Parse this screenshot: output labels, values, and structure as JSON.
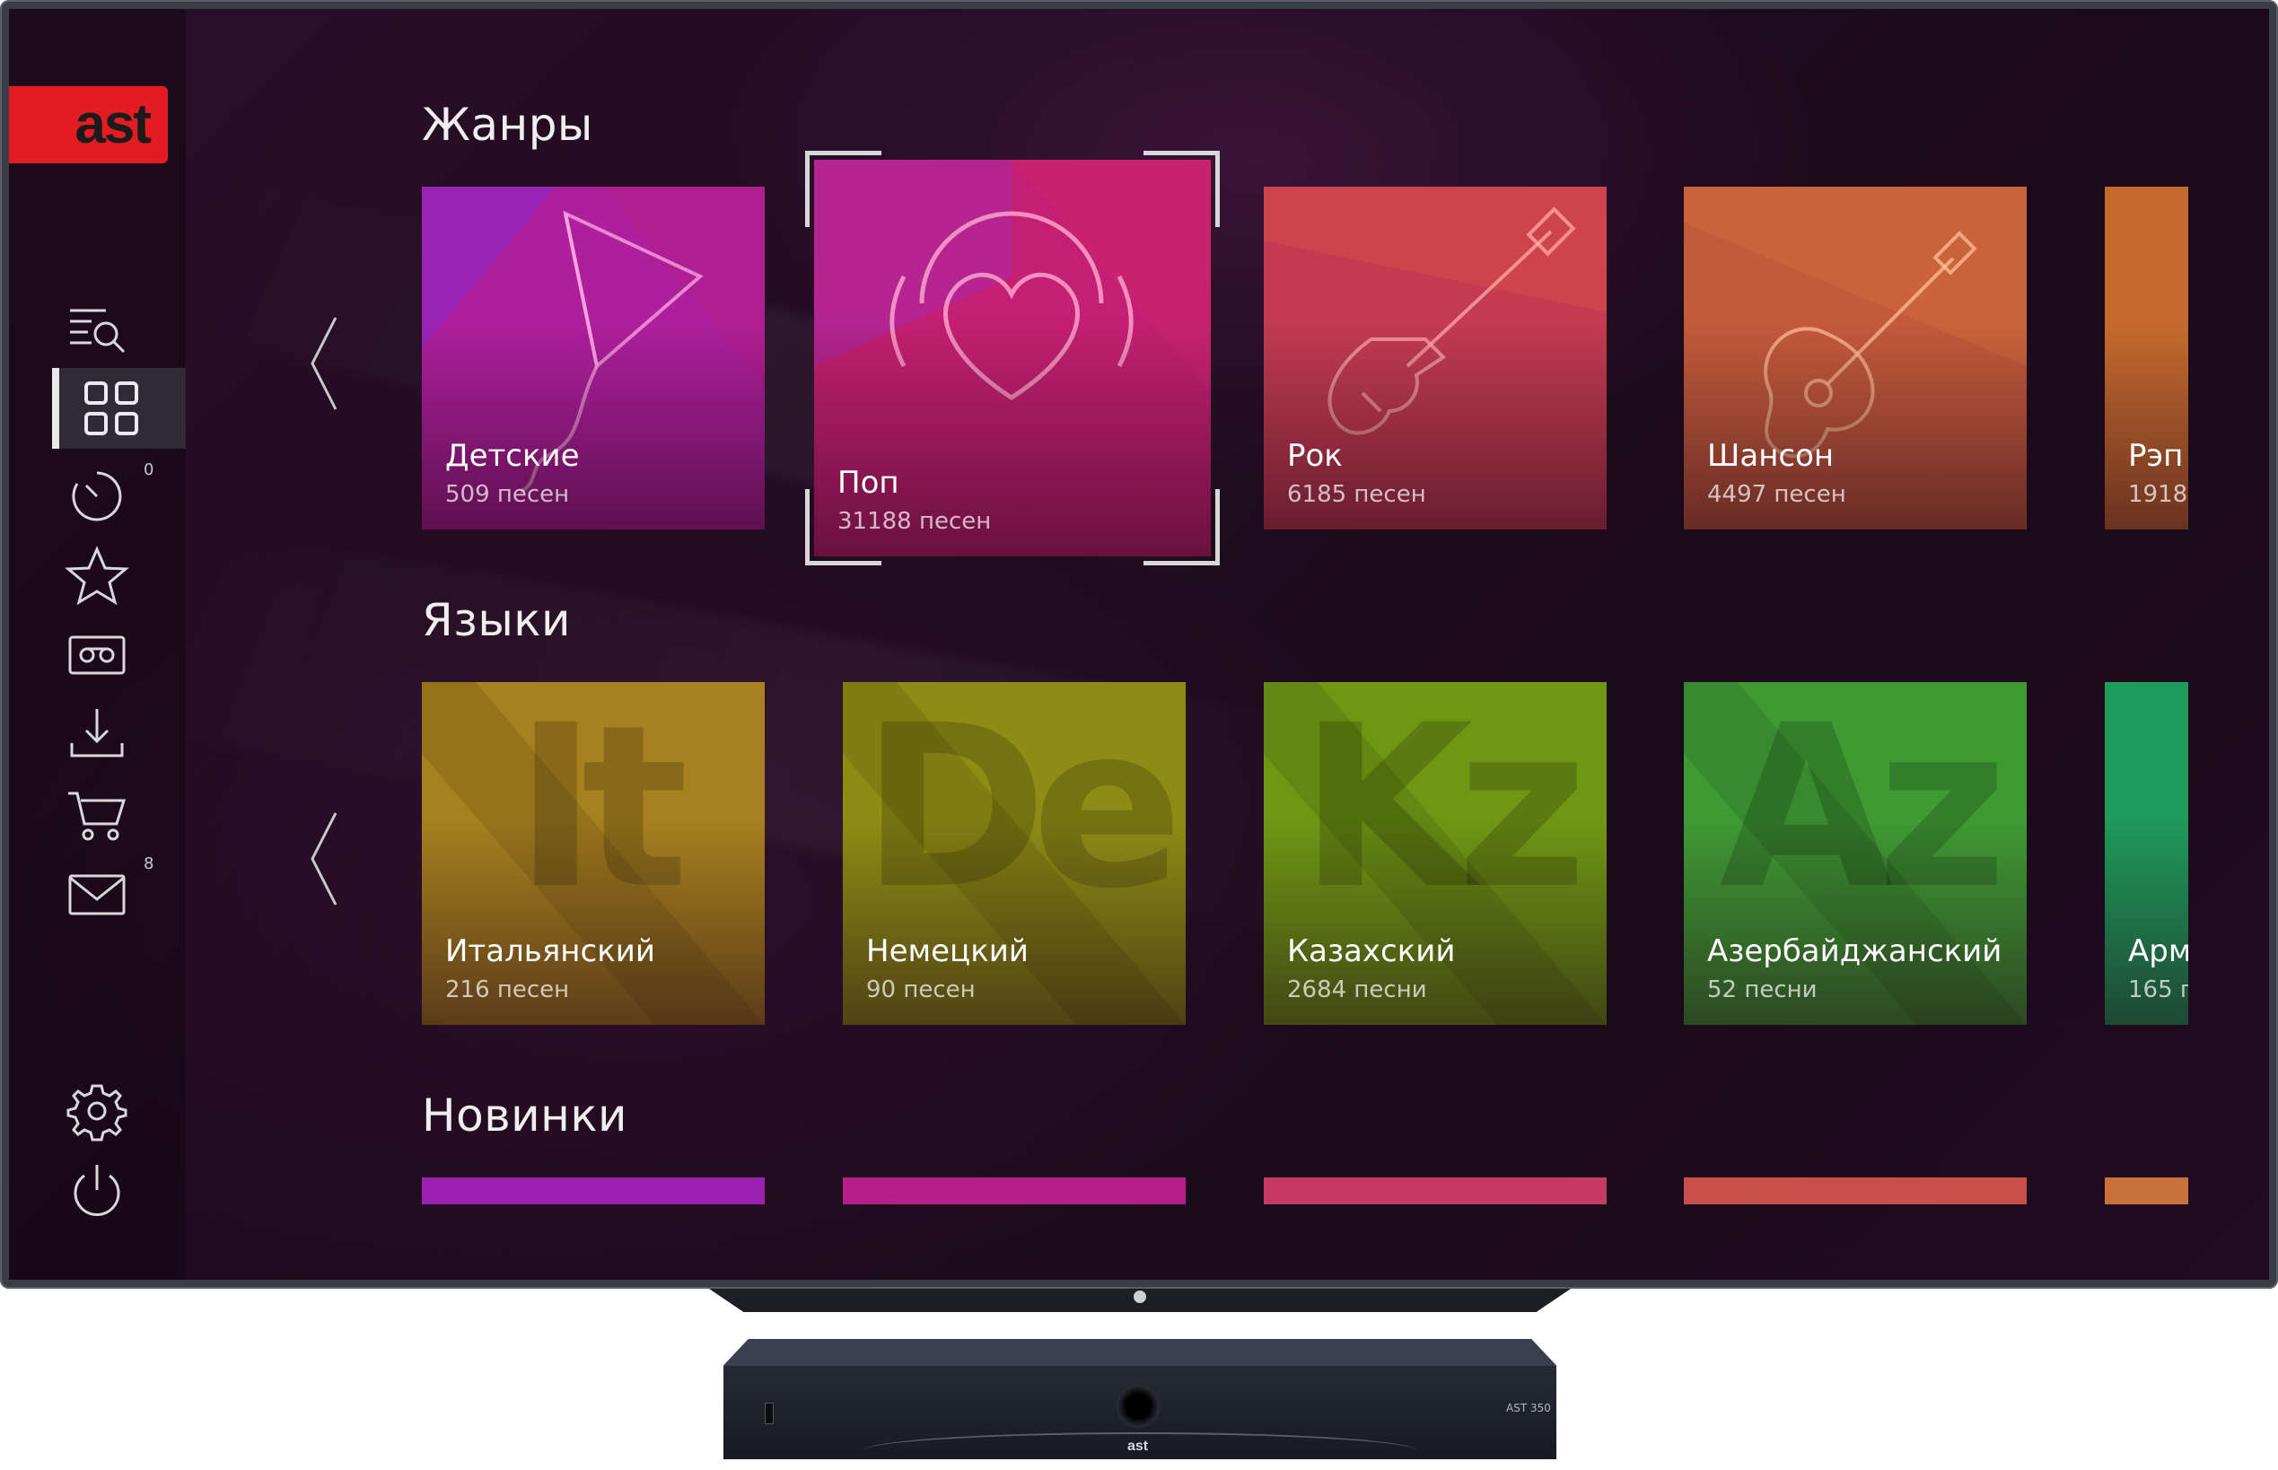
{
  "brand": {
    "logo_text": "ast"
  },
  "sidebar": {
    "items": [
      {
        "icon": "search-list-icon"
      },
      {
        "icon": "grid-icon",
        "active": true
      },
      {
        "icon": "timer-icon",
        "badge": "0"
      },
      {
        "icon": "star-icon"
      },
      {
        "icon": "cassette-icon"
      },
      {
        "icon": "download-icon"
      },
      {
        "icon": "cart-icon"
      },
      {
        "icon": "mail-icon",
        "badge": "8"
      },
      {
        "icon": "gear-icon"
      },
      {
        "icon": "power-icon"
      }
    ]
  },
  "sections": {
    "genres": {
      "title": "Жанры",
      "tiles": [
        {
          "name": "Детские",
          "count": "509 песен",
          "icon": "kite-icon"
        },
        {
          "name": "Поп",
          "count": "31188 песен",
          "icon": "heart-headphones-icon",
          "focused": true
        },
        {
          "name": "Рок",
          "count": "6185 песен",
          "icon": "electric-guitar-icon"
        },
        {
          "name": "Шансон",
          "count": "4497 песен",
          "icon": "acoustic-guitar-icon"
        },
        {
          "name": "Рэп",
          "count": "1918 п"
        }
      ]
    },
    "languages": {
      "title": "Языки",
      "tiles": [
        {
          "name": "Итальянский",
          "count": "216 песен",
          "glyph": "It"
        },
        {
          "name": "Немецкий",
          "count": "90 песен",
          "glyph": "De"
        },
        {
          "name": "Казахский",
          "count": "2684 песни",
          "glyph": "Kz"
        },
        {
          "name": "Азербайджанский",
          "count": "52 песни",
          "glyph": "Az"
        },
        {
          "name": "Арм",
          "count": "165 п"
        }
      ]
    },
    "new": {
      "title": "Новинки"
    }
  },
  "colors": {
    "logo": "#e21c22",
    "tile_kids": "#b31f9a",
    "tile_pop": "#c2206e",
    "tile_rock": "#c23a4f",
    "tile_chanson": "#c45a3c",
    "tile_rap": "#c56a2e",
    "tile_it": "#a7801f",
    "tile_de": "#8f8c15",
    "tile_kz": "#6f9714",
    "tile_az": "#3f9a34",
    "tile_arm": "#1e9a5a"
  },
  "set_top_box": {
    "label": "AST 350",
    "logo_text": "ast"
  }
}
